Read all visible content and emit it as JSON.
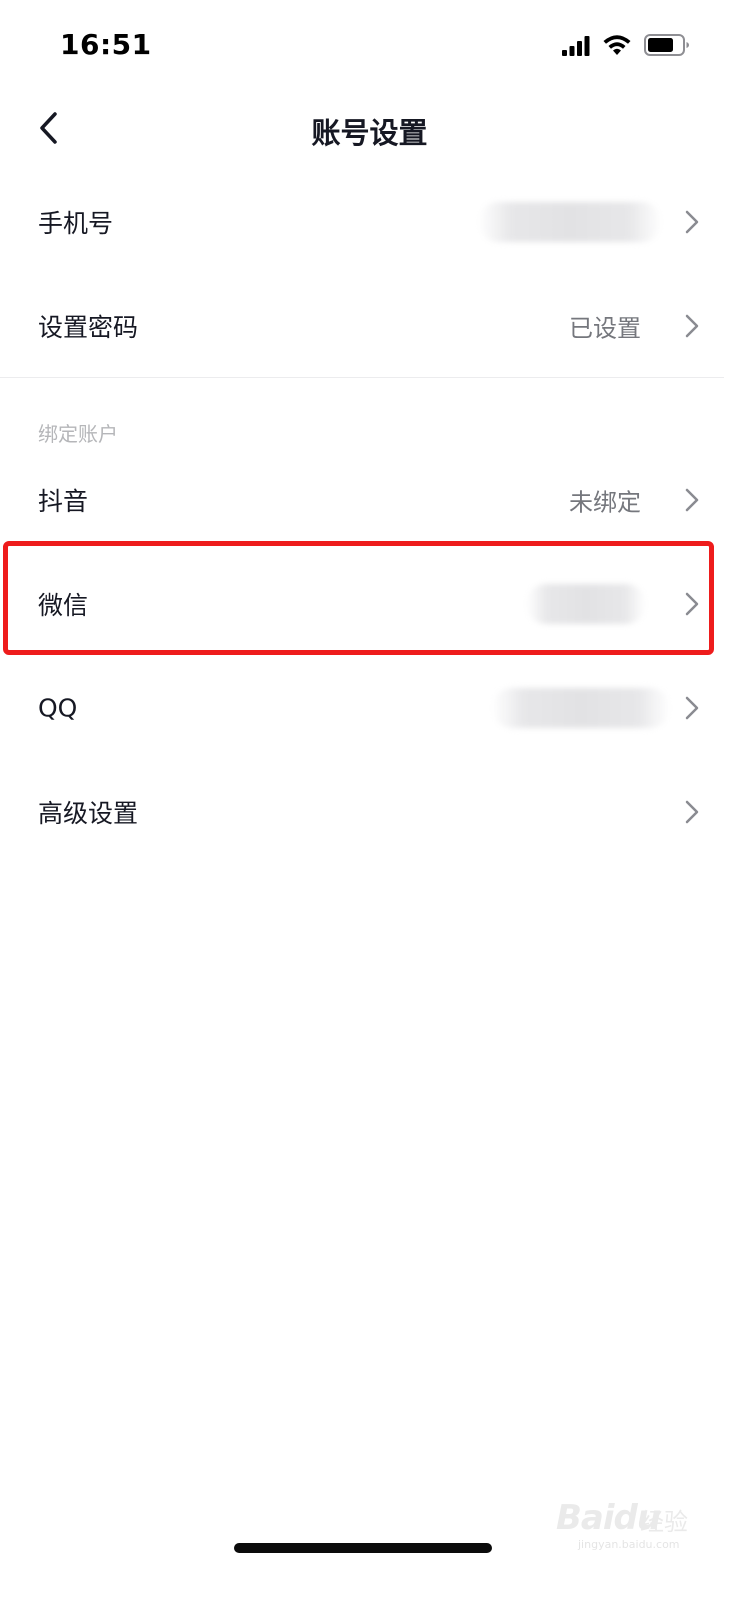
{
  "status_bar": {
    "time": "16:51",
    "icons": [
      "signal-icon",
      "wifi-icon",
      "battery-icon"
    ]
  },
  "header": {
    "title": "账号设置",
    "back_icon": "chevron-left-icon"
  },
  "rows": {
    "phone": {
      "label": "手机号",
      "value": "",
      "value_blurred": true
    },
    "password": {
      "label": "设置密码",
      "value": "已设置"
    },
    "douyin": {
      "label": "抖音",
      "value": "未绑定"
    },
    "wechat": {
      "label": "微信",
      "value": "",
      "value_blurred": true
    },
    "qq": {
      "label": "QQ",
      "value": "",
      "value_blurred": true
    },
    "advanced": {
      "label": "高级设置"
    }
  },
  "sections": {
    "bound_accounts": "绑定账户"
  },
  "watermark": {
    "brand": "Baidu",
    "cn": "经验",
    "url": "jingyan.baidu.com"
  },
  "colors": {
    "highlight": "#ee1c1c",
    "text_primary": "#161823",
    "text_secondary": "#75777d",
    "section_header": "#b5b6b9"
  }
}
